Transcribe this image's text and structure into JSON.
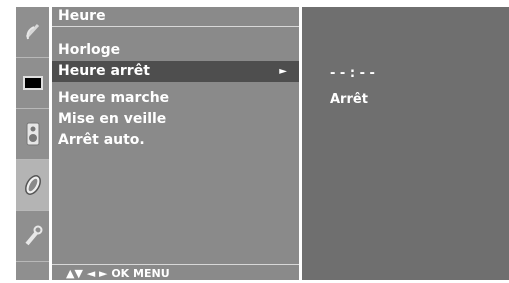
{
  "sidebar": {
    "items": [
      {
        "icon": "satellite-dish-icon"
      },
      {
        "icon": "tv-screen-icon",
        "selected": true
      },
      {
        "icon": "speaker-icon"
      },
      {
        "icon": "clock-icon"
      },
      {
        "icon": "wrench-icon"
      }
    ]
  },
  "menu": {
    "title": "Heure",
    "items": [
      {
        "label": "Horloge"
      },
      {
        "label": "Heure arrêt",
        "selected": true,
        "arrow": "►"
      },
      {
        "label": "Heure marche"
      },
      {
        "label": "Mise en veille"
      },
      {
        "label": "Arrêt auto."
      }
    ],
    "footer": "▲▼  ◄ ►  OK  MENU"
  },
  "submenu": {
    "time_value": "- - : - -",
    "status_value": "Arrêt"
  },
  "colors": {
    "menu_bg": "#8a8a8a",
    "selected_row": "#4e4e4e",
    "panel_bg": "#6f6f6f",
    "sidebar_bg": "#8f8f8f"
  }
}
